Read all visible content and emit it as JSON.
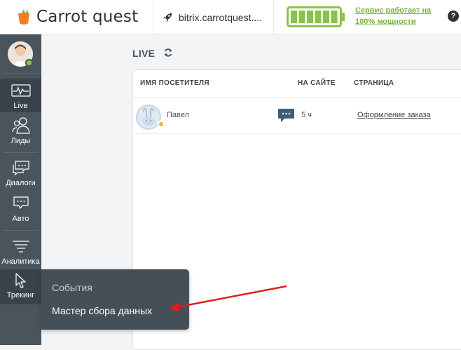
{
  "brand": {
    "name": "Carrot quest"
  },
  "header": {
    "site": "bitrix.carrotquest....",
    "status_text": "Сервис работает на 100% мощности",
    "help_label": "?"
  },
  "colors": {
    "sidebar": "#4a545c",
    "sidebar_active": "#39424a",
    "accent_green": "#7cb342",
    "status_online": "#8bc34a",
    "status_away": "#f5b521",
    "chat_blue": "#3f5d78",
    "arrow_red": "#e21b1b"
  },
  "sidebar": {
    "items": [
      {
        "label": "Live",
        "icon": "pulse-monitor-icon"
      },
      {
        "label": "Лиды",
        "icon": "users-icon"
      },
      {
        "label": "Диалоги",
        "icon": "chat-bubbles-icon"
      },
      {
        "label": "Авто",
        "icon": "auto-message-icon"
      },
      {
        "label": "Аналитика",
        "icon": "analytics-icon"
      },
      {
        "label": "Трекинг",
        "icon": "cursor-icon"
      }
    ]
  },
  "main": {
    "title": "LIVE",
    "columns": [
      "ИМЯ ПОСЕТИТЕЛЯ",
      "НА САЙТЕ",
      "СТРАНИЦА"
    ],
    "rows": [
      {
        "name": "Павел",
        "time_on_site": "5 ч",
        "page": "Оформление заказа"
      }
    ]
  },
  "popup_menu": {
    "items": [
      "События",
      "Мастер сбора данных"
    ]
  }
}
